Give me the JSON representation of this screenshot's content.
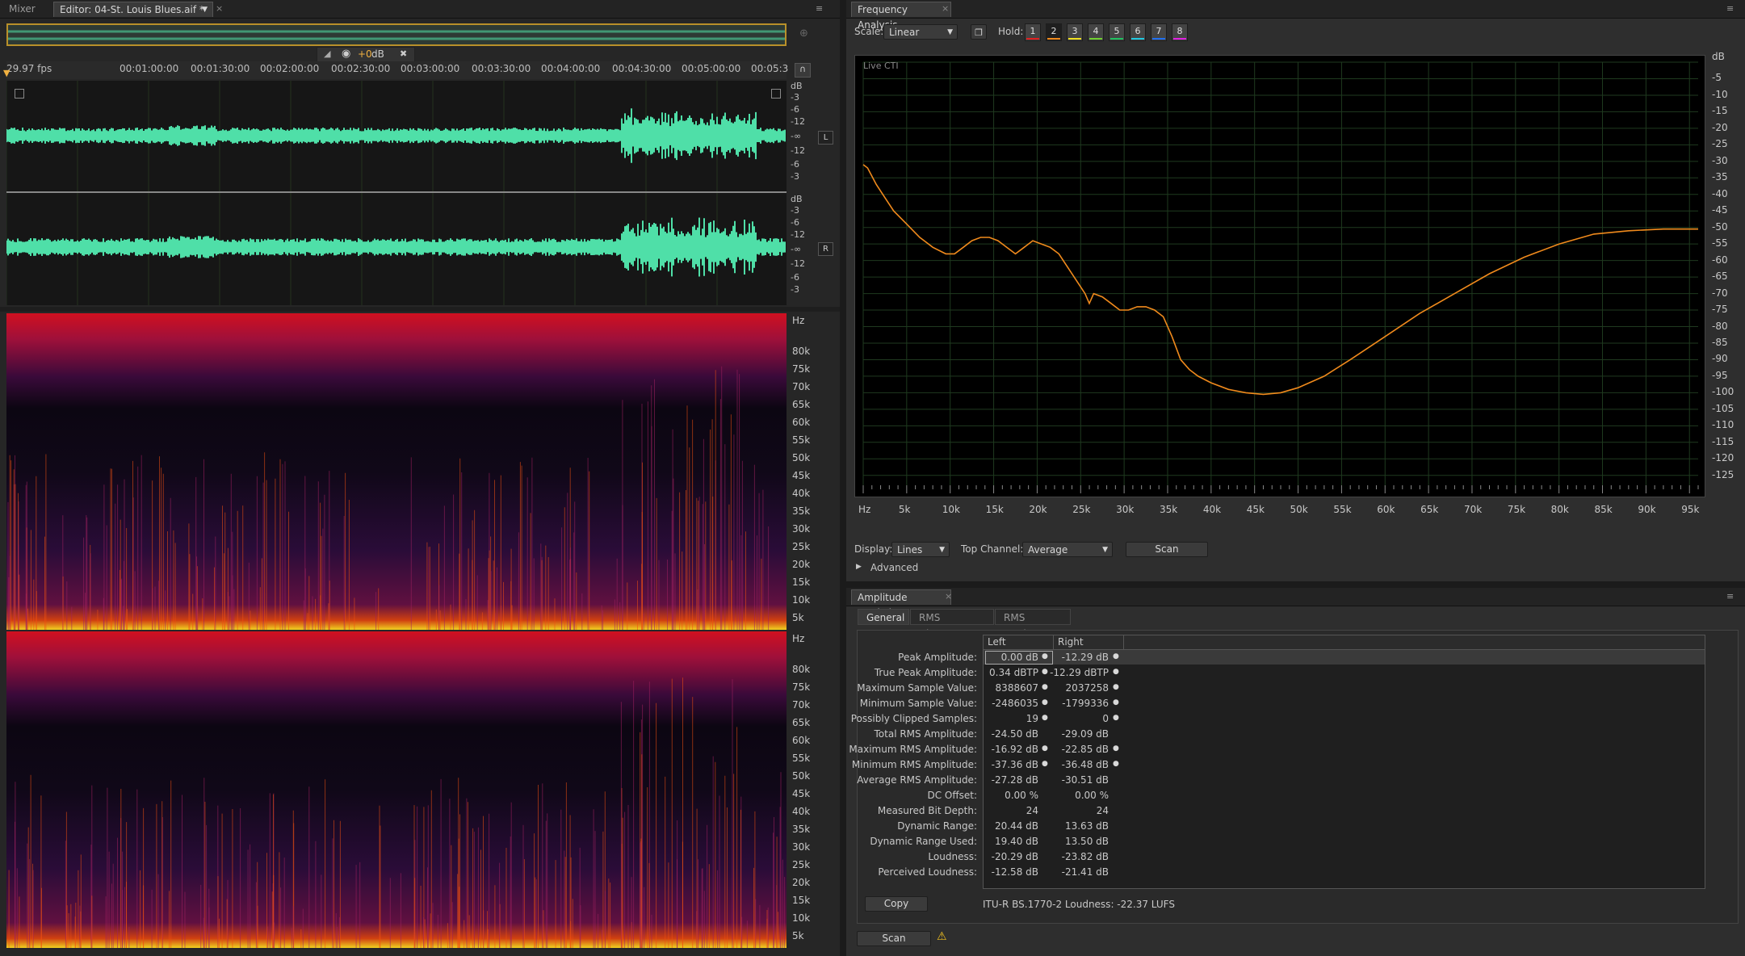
{
  "editor": {
    "tabs": [
      {
        "label": "Mixer"
      },
      {
        "label": "Editor: 04-St. Louis Blues.aif *"
      }
    ],
    "volume": "+0",
    "volume_unit": "dB",
    "fps": "29.97 fps",
    "time_ticks": [
      "00:01:00:00",
      "00:01:30:00",
      "00:02:00:00",
      "00:02:30:00",
      "00:03:00:00",
      "00:03:30:00",
      "00:04:00:00",
      "00:04:30:00",
      "00:05:00:00",
      "00:05:3"
    ],
    "db_scale_unit": "dB",
    "db_scale": [
      "-3",
      "-6",
      "-12",
      "-∞",
      "-12",
      "-6",
      "-3"
    ],
    "channels": [
      "L",
      "R"
    ],
    "hz_unit": "Hz",
    "hz_scale": [
      "80k",
      "75k",
      "70k",
      "65k",
      "60k",
      "55k",
      "50k",
      "45k",
      "40k",
      "35k",
      "30k",
      "25k",
      "20k",
      "15k",
      "10k",
      "5k"
    ]
  },
  "frequency_analysis": {
    "title": "Frequency Analysis",
    "scale_label": "Scale:",
    "scale_value": "Linear",
    "hold_label": "Hold:",
    "hold_buttons": [
      {
        "label": "1",
        "color": "#e02020"
      },
      {
        "label": "2",
        "color": "#f08a1c"
      },
      {
        "label": "3",
        "color": "#f0e020"
      },
      {
        "label": "4",
        "color": "#70d030"
      },
      {
        "label": "5",
        "color": "#20c060"
      },
      {
        "label": "6",
        "color": "#20c8e0"
      },
      {
        "label": "7",
        "color": "#2070f0"
      },
      {
        "label": "8",
        "color": "#e020e0"
      }
    ],
    "live_label": "Live CTI",
    "display_label": "Display:",
    "display_value": "Lines",
    "top_channel_label": "Top Channel:",
    "top_channel_value": "Average",
    "scan_label": "Scan",
    "advanced_label": "Advanced"
  },
  "chart_data": {
    "type": "line",
    "x_unit": "Hz",
    "x_ticks": [
      "5k",
      "10k",
      "15k",
      "20k",
      "25k",
      "30k",
      "35k",
      "40k",
      "45k",
      "50k",
      "55k",
      "60k",
      "65k",
      "70k",
      "75k",
      "80k",
      "85k",
      "90k",
      "95k"
    ],
    "y_unit": "dB",
    "y_ticks": [
      "-5",
      "-10",
      "-15",
      "-20",
      "-25",
      "-30",
      "-35",
      "-40",
      "-45",
      "-50",
      "-55",
      "-60",
      "-65",
      "-70",
      "-75",
      "-80",
      "-85",
      "-90",
      "-95",
      "-100",
      "-105",
      "-110",
      "-115",
      "-120",
      "-125"
    ],
    "xlim": [
      0,
      96000
    ],
    "ylim": [
      -128,
      0
    ],
    "grid": true,
    "series": [
      {
        "color": "#f08a1c",
        "x": [
          0,
          500,
          1500,
          2500,
          3500,
          5000,
          6500,
          8000,
          9500,
          10500,
          11500,
          12500,
          13500,
          14500,
          15500,
          16500,
          17500,
          18500,
          19500,
          20500,
          21500,
          22500,
          23500,
          24500,
          25500,
          26000,
          26500,
          27500,
          28500,
          29500,
          30500,
          31500,
          32500,
          33500,
          34500,
          35500,
          36500,
          37500,
          38500,
          40000,
          42000,
          44000,
          46000,
          48000,
          50000,
          53000,
          56000,
          60000,
          64000,
          68000,
          72000,
          76000,
          80000,
          84000,
          88000,
          92000,
          96000
        ],
        "y": [
          -31,
          -32,
          -37,
          -41,
          -45,
          -49,
          -53,
          -56,
          -58,
          -58,
          -56,
          -54,
          -53,
          -53,
          -54,
          -56,
          -58,
          -56,
          -54,
          -55,
          -56,
          -58,
          -62,
          -66,
          -70,
          -73,
          -70,
          -71,
          -73,
          -75,
          -75,
          -74,
          -74,
          -75,
          -77,
          -83,
          -90,
          -93,
          -95,
          -97,
          -99,
          -100,
          -100.5,
          -100,
          -98.5,
          -95,
          -90,
          -83,
          -76,
          -70,
          -64,
          -59,
          -55,
          -52,
          -51,
          -50.5,
          -50.5
        ]
      }
    ]
  },
  "amplitude_statistics": {
    "title": "Amplitude Statistics",
    "subtabs": [
      "General",
      "RMS Histogram",
      "RMS Settings"
    ],
    "columns": [
      "Left",
      "Right"
    ],
    "rows": [
      {
        "label": "Peak Amplitude:",
        "left": "0.00 dB",
        "right": "-12.29 dB",
        "pin": true
      },
      {
        "label": "True Peak Amplitude:",
        "left": "0.34 dBTP",
        "right": "-12.29 dBTP",
        "pin": true
      },
      {
        "label": "Maximum Sample Value:",
        "left": "8388607",
        "right": "2037258",
        "pin": true
      },
      {
        "label": "Minimum Sample Value:",
        "left": "-2486035",
        "right": "-1799336",
        "pin": true
      },
      {
        "label": "Possibly Clipped Samples:",
        "left": "19",
        "right": "0",
        "pin": true
      },
      {
        "label": "Total RMS Amplitude:",
        "left": "-24.50 dB",
        "right": "-29.09 dB",
        "pin": false
      },
      {
        "label": "Maximum RMS Amplitude:",
        "left": "-16.92 dB",
        "right": "-22.85 dB",
        "pin": true
      },
      {
        "label": "Minimum RMS Amplitude:",
        "left": "-37.36 dB",
        "right": "-36.48 dB",
        "pin": true
      },
      {
        "label": "Average RMS Amplitude:",
        "left": "-27.28 dB",
        "right": "-30.51 dB",
        "pin": false
      },
      {
        "label": "DC Offset:",
        "left": "0.00 %",
        "right": "0.00 %",
        "pin": false
      },
      {
        "label": "Measured Bit Depth:",
        "left": "24",
        "right": "24",
        "pin": false
      },
      {
        "label": "Dynamic Range:",
        "left": "20.44 dB",
        "right": "13.63 dB",
        "pin": false
      },
      {
        "label": "Dynamic Range Used:",
        "left": "19.40 dB",
        "right": "13.50 dB",
        "pin": false
      },
      {
        "label": "Loudness:",
        "left": "-20.29 dB",
        "right": "-23.82 dB",
        "pin": false
      },
      {
        "label": "Perceived Loudness:",
        "left": "-12.58 dB",
        "right": "-21.41 dB",
        "pin": false
      }
    ],
    "copy_label": "Copy",
    "loudness_note": "ITU-R BS.1770-2 Loudness: -22.37 LUFS",
    "scan_label": "Scan"
  }
}
